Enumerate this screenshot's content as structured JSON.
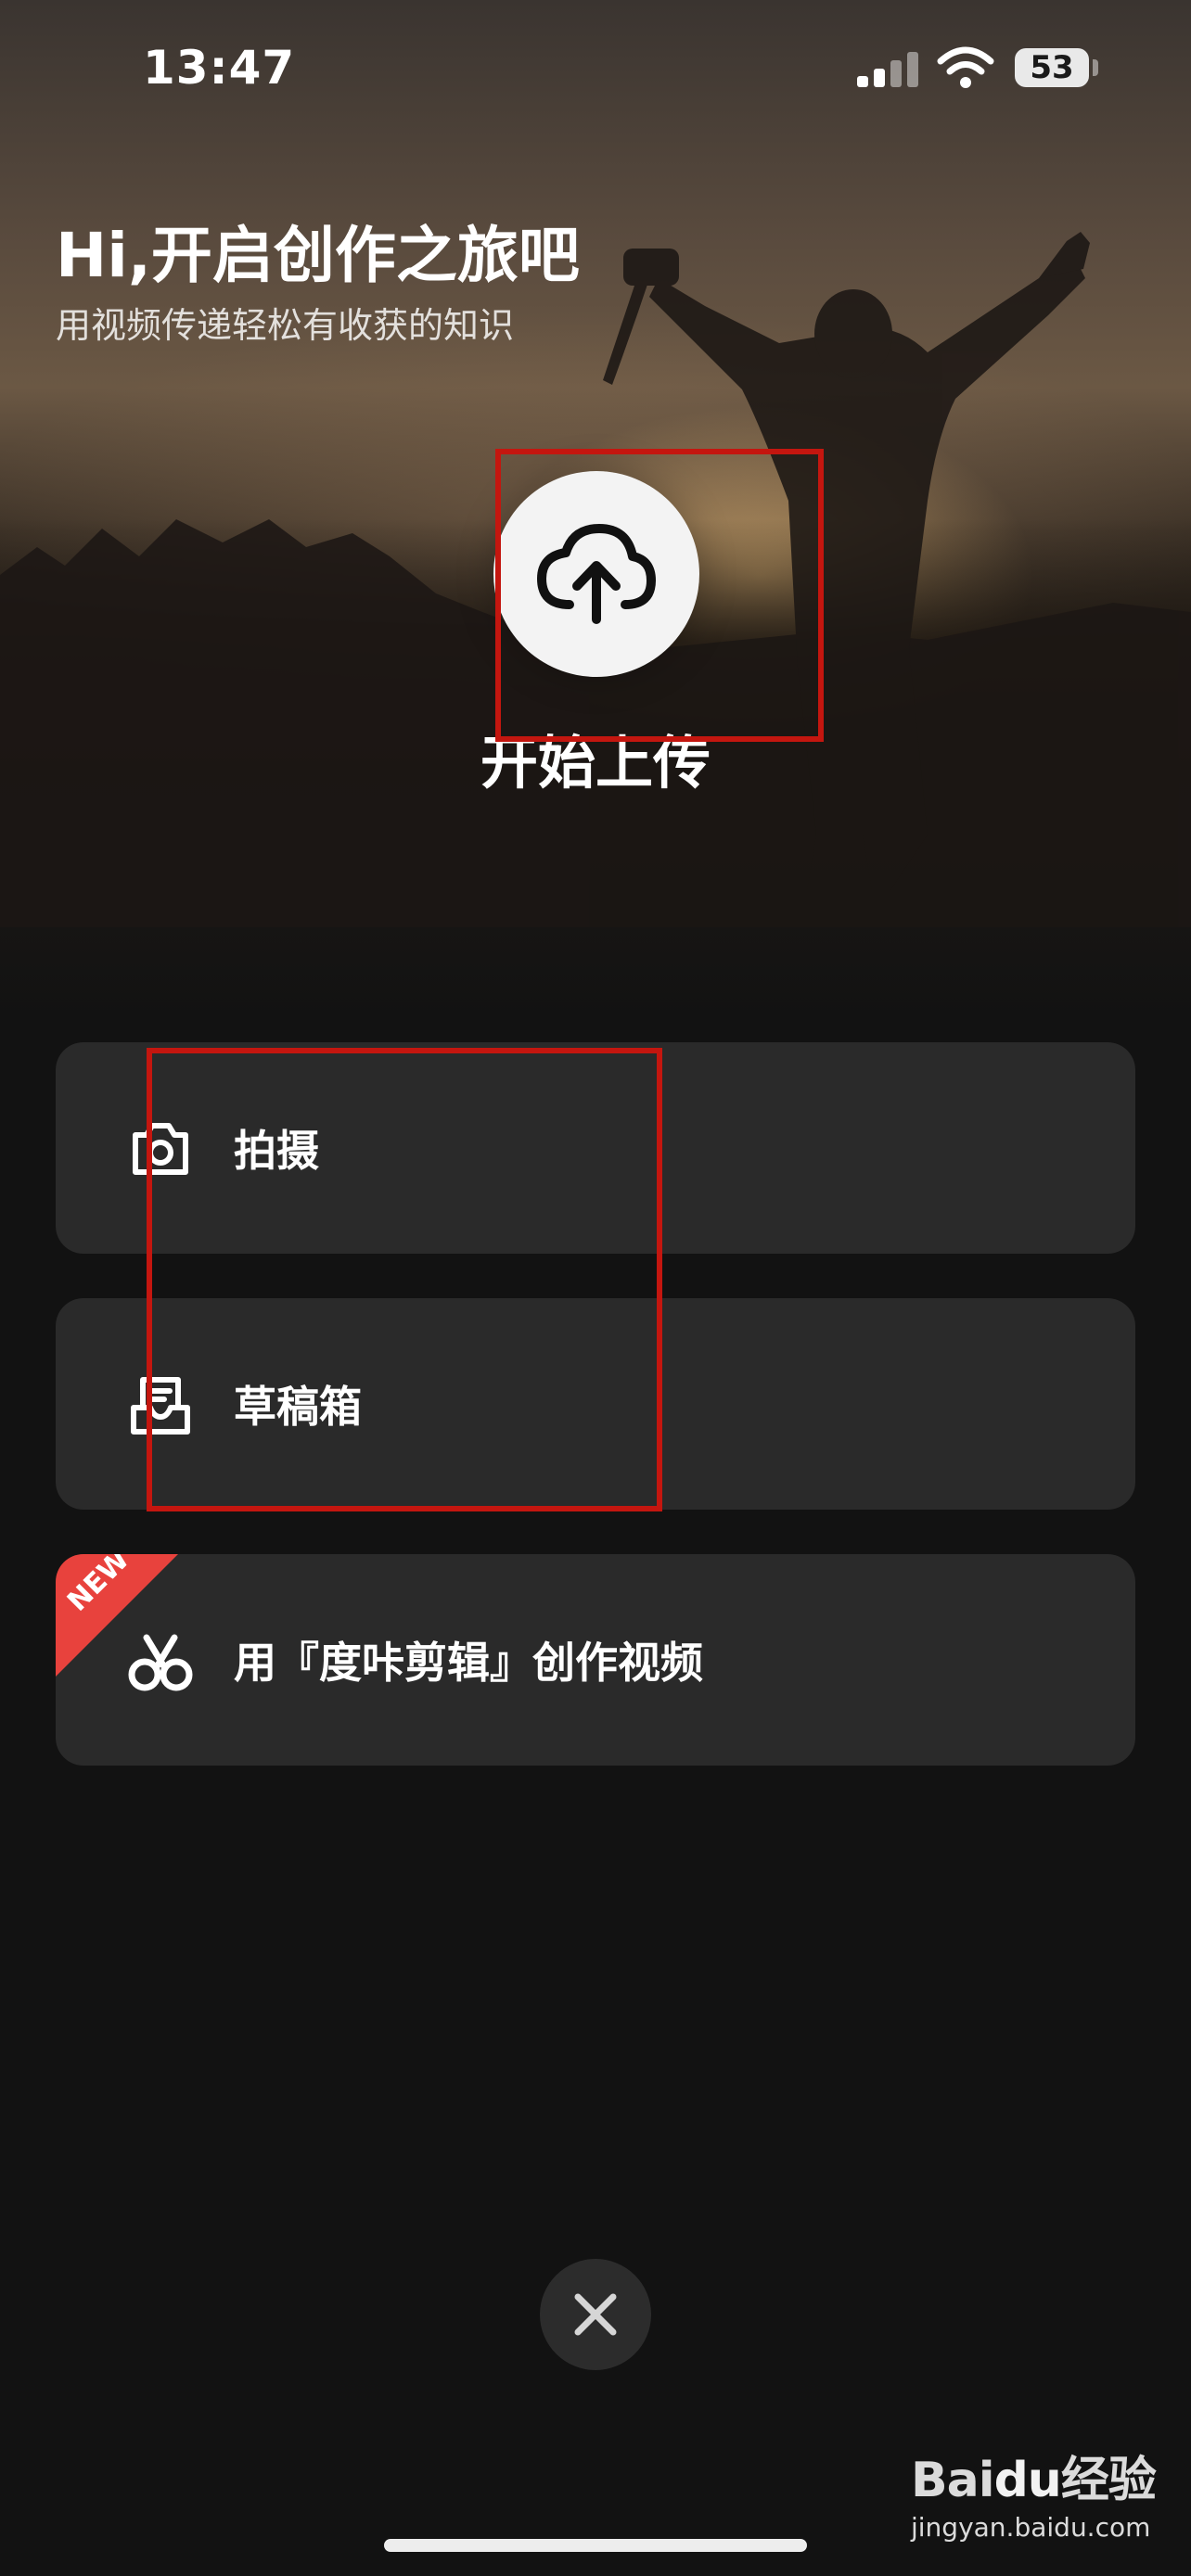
{
  "status_bar": {
    "time": "13:47",
    "battery": "53"
  },
  "header": {
    "greeting": "Hi,开启创作之旅吧",
    "subtitle": "用视频传递轻松有收获的知识"
  },
  "upload": {
    "label": "开始上传",
    "icon": "cloud-upload-icon"
  },
  "menu": [
    {
      "label": "拍摄",
      "icon": "camera-icon"
    },
    {
      "label": "草稿箱",
      "icon": "draft-box-icon"
    },
    {
      "label": "用『度咔剪辑』创作视频",
      "icon": "duka-scissors-icon",
      "badge": "NEW"
    }
  ],
  "close": {
    "icon": "close-icon"
  },
  "watermark": {
    "logo_bai": "Bai",
    "logo_du": "du",
    "logo_jingyan": "经验",
    "site": "jingyan.baidu.com"
  },
  "colors": {
    "background": "#121212",
    "card": "#2a2a2a",
    "highlight": "#c4160f",
    "new_badge": "#e8423d"
  }
}
